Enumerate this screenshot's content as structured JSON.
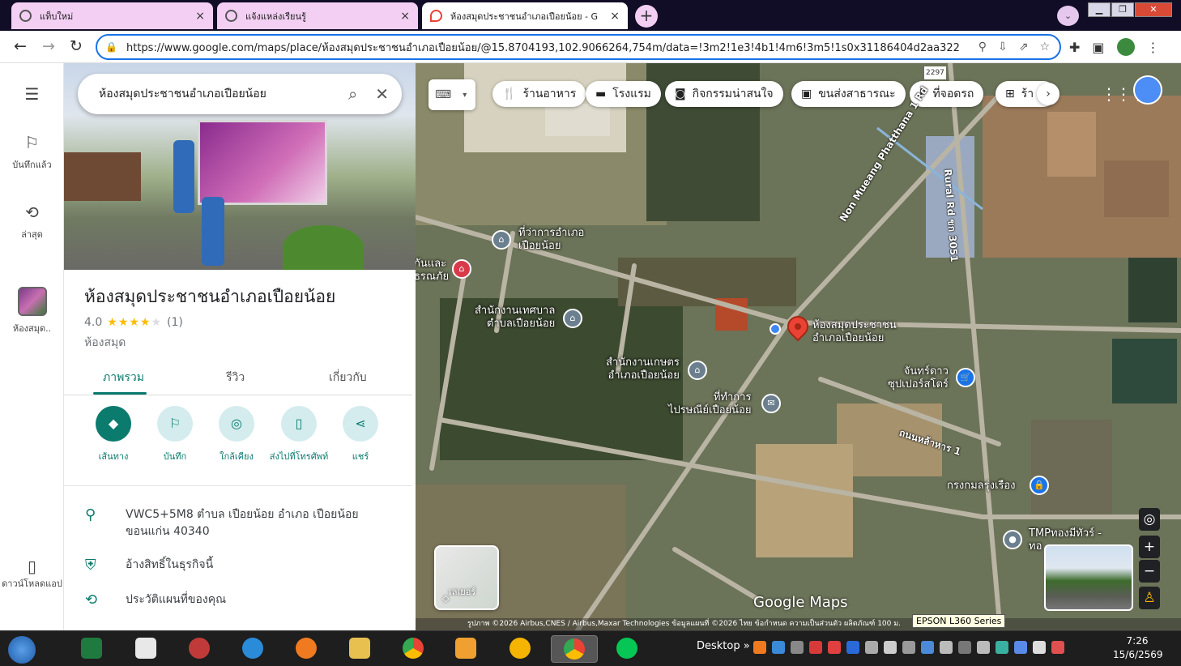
{
  "browser": {
    "tabs": [
      {
        "title": "แท็บใหม่",
        "close": "×"
      },
      {
        "title": "แจ้งแหล่งเรียนรู้",
        "close": "×"
      },
      {
        "title": "ห้องสมุดประชาชนอำเภอเปือยน้อย - G",
        "close": "×"
      }
    ],
    "new_tab": "+",
    "url": "https://www.google.com/maps/place/ห้องสมุดประชาชนอำเภอเปือยน้อย/@15.8704193,102.9066264,754m/data=!3m2!1e3!4b1!4m6!3m5!1s0x31186404d2aa322"
  },
  "rail": {
    "saved": "บันทึกแล้ว",
    "recent": "ล่าสุด",
    "place_short": "ห้องสมุด..",
    "download_app": "ดาวน์โหลดแอป"
  },
  "search": {
    "query": "ห้องสมุดประชาชนอำเภอเปือยน้อย"
  },
  "place": {
    "title": "ห้องสมุดประชาชนอำเภอเปือยน้อย",
    "rating": "4.0",
    "stars": "★★★★",
    "empty_star": "★",
    "reviews": "(1)",
    "category": "ห้องสมุด",
    "tabs": [
      "ภาพรวม",
      "รีวิว",
      "เกี่ยวกับ"
    ],
    "actions": [
      "เส้นทาง",
      "บันทึก",
      "ใกล้เคียง",
      "ส่งไปที่โทรศัพท์",
      "แชร์"
    ],
    "address": "VWC5+5M8 ตำบล เปือยน้อย อำเภอ เปือยน้อย ขอนแก่น 40340",
    "claim": "อ้างสิทธิ์ในธุรกิจนี้",
    "history": "ประวัติแผนที่ของคุณ"
  },
  "map": {
    "chips": [
      "ร้านอาหาร",
      "โรงแรม",
      "กิจกรรมน่าสนใจ",
      "ขนส่งสาธารณะ",
      "ที่จอดรถ",
      "ร้า"
    ],
    "labels": {
      "district_office": "ที่ว่าการอำเภอ\nเปือยน้อย",
      "municipality": "สำนักงานเทศบาล\nตำบลเปือยน้อย",
      "agri_office": "สำนักงานเกษตร\nอำเภอเปือยน้อย",
      "post_office": "ที่ทำการ\nไปรษณีย์เปือยน้อย",
      "library": "ห้องสมุดประชาชน\nอำเภอเปือยน้อย",
      "disaster": "กันและ\nธรณภัย",
      "supermarket": "จันทร์ดาว\nซุปเปอร์สโตร์",
      "krungkam": "กรงกมลรุ่งเรือง",
      "tmp": "TMPทองมีทัวร์ -\nทอ",
      "road1": "Non Mueang Phatthana 1 Rd",
      "road2": "Rural Rd ขก 3051",
      "road3": "ถนนหล้าหาร 1",
      "road4": "2297"
    },
    "layers": "เลเยอร์",
    "logo": "Google Maps",
    "attribution": "รูปภาพ ©2026 Airbus,CNES / Airbus,Maxar Technologies ข้อมูลแผนที่ ©2026   ไทย   ข้อกำหนด   ความเป็นส่วนตัว   ผลิตภัณฑ์   100 ม.",
    "printer_tooltip": "EPSON L360 Series"
  },
  "taskbar": {
    "desktop": "Desktop",
    "chevron": "»",
    "time": "7:26",
    "date": "15/6/2569"
  }
}
